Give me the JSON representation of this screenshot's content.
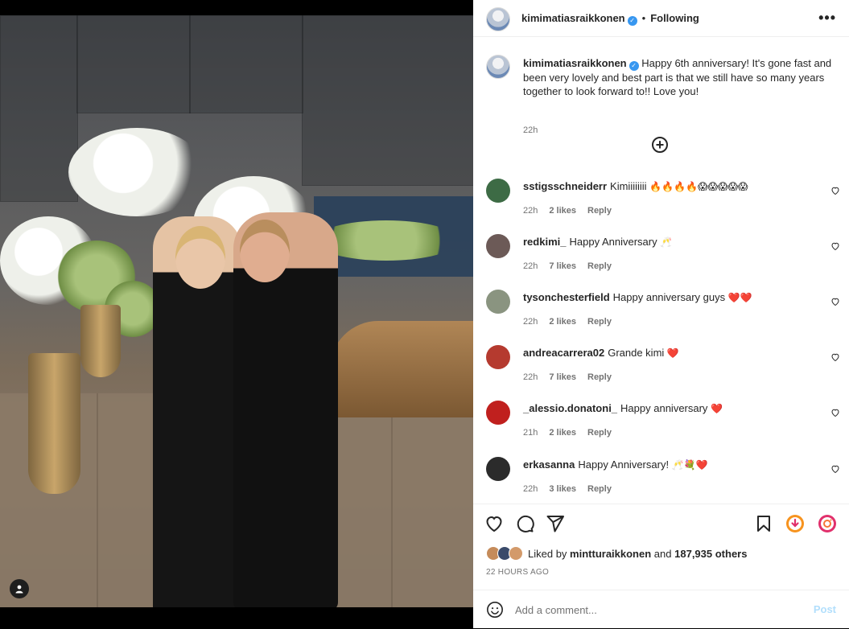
{
  "post": {
    "username": "kimimatiasraikkonen",
    "verified_mark": "✓",
    "separator": "•",
    "follow_status": "Following",
    "more_icon": "•••",
    "caption": "Happy 6th anniversary! It's gone fast and been very lovely and best part is that we still have so many years together to look forward to!! Love you!",
    "caption_time": "22h",
    "load_more_icon": "+"
  },
  "comments": [
    {
      "user": "sstigsschneiderr",
      "text": "Kimiiiiiiii",
      "emoji": "🔥🔥🔥🔥😱😱😱😱😱",
      "time": "22h",
      "likes": "2 likes",
      "reply": "Reply",
      "avatar_color": "#3d6b45"
    },
    {
      "user": "redkimi_",
      "text": "Happy Anniversary",
      "emoji": "🥂",
      "time": "22h",
      "likes": "7 likes",
      "reply": "Reply",
      "avatar_color": "#6c5a57"
    },
    {
      "user": "tysonchesterfield",
      "text": "Happy anniversary guys",
      "emoji": "❤️❤️",
      "time": "22h",
      "likes": "2 likes",
      "reply": "Reply",
      "avatar_color": "#8a9480"
    },
    {
      "user": "andreacarrera02",
      "text": "Grande kimi",
      "emoji": "❤️",
      "time": "22h",
      "likes": "7 likes",
      "reply": "Reply",
      "avatar_color": "#b53a2f"
    },
    {
      "user": "_alessio.donatoni_",
      "text": "Happy anniversary",
      "emoji": "❤️",
      "time": "21h",
      "likes": "2 likes",
      "reply": "Reply",
      "avatar_color": "#c0201e"
    },
    {
      "user": "erkasanna",
      "text": "Happy Anniversary!",
      "emoji": "🥂💐❤️",
      "time": "22h",
      "likes": "3 likes",
      "reply": "Reply",
      "avatar_color": "#2b2b2b"
    }
  ],
  "actions": {
    "like_icon": "heart-icon",
    "comment_icon": "comment-icon",
    "share_icon": "paper-plane-icon",
    "save_icon": "bookmark-icon"
  },
  "likes": {
    "prefix": "Liked by",
    "user": "mintturaikkonen",
    "middle": "and",
    "count": "187,935 others"
  },
  "timestamp": "22 HOURS AGO",
  "add_comment": {
    "placeholder": "Add a comment...",
    "post_label": "Post"
  },
  "colors": {
    "verified": "#3797f0",
    "heart_red": "#ff3040",
    "post_disabled": "#b2dffc",
    "meta_gray": "#737373"
  }
}
